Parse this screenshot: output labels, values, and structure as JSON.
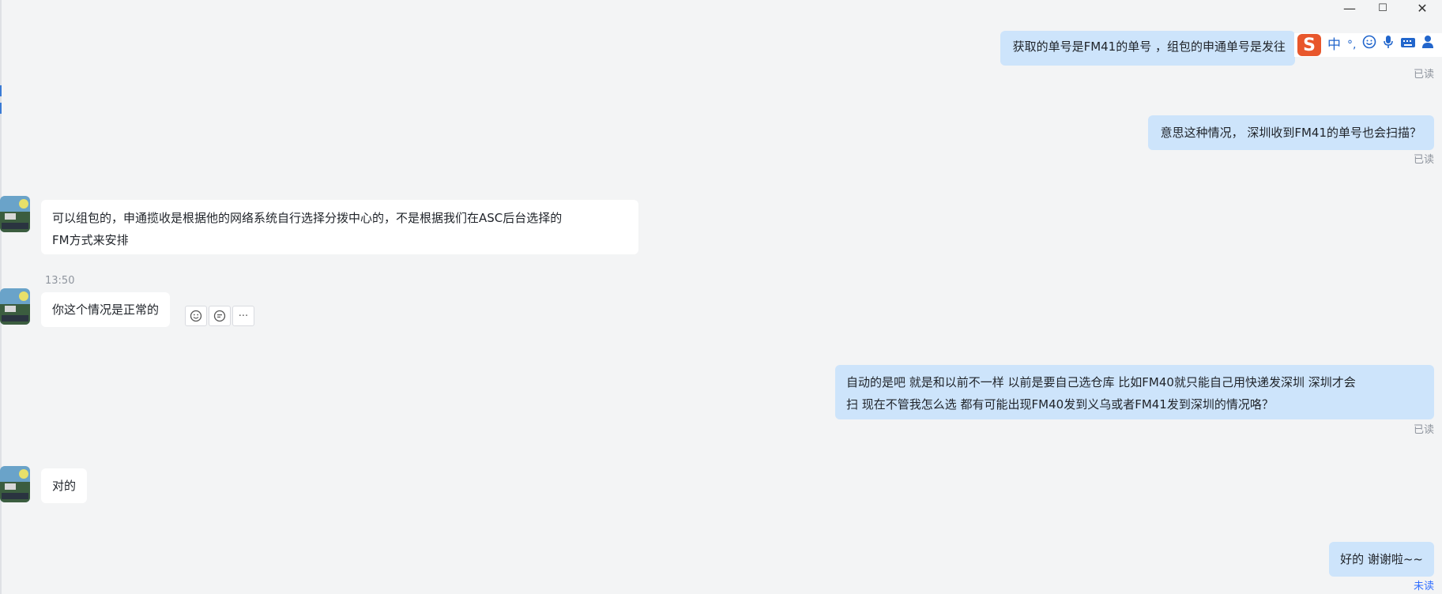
{
  "window": {
    "minimize_glyph": "—",
    "maximize_glyph": "☐",
    "close_glyph": "✕"
  },
  "messages": [
    {
      "dir": "out",
      "text": "获取的单号是FM41的单号 ，组包的申通单号是发往",
      "status": "已读"
    },
    {
      "dir": "out",
      "text": "意思这种情况， 深圳收到FM41的单号也会扫描？",
      "status": "已读"
    },
    {
      "dir": "in",
      "lines": [
        "可以组包的，申通揽收是根据他的网络系统自行选择分拨中心的，不是根据我们在ASC后台选择的",
        "FM方式来安排"
      ]
    },
    {
      "dir": "in",
      "time": "13:50",
      "text": "你这个情况是正常的"
    },
    {
      "dir": "out",
      "lines": [
        "自动的是吧  就是和以前不一样 以前是要自己选仓库 比如FM40就只能自己用快递发深圳 深圳才会",
        "扫  现在不管我怎么选 都有可能出现FM40发到义乌或者FM41发到深圳的情况咯？"
      ],
      "status": "已读"
    },
    {
      "dir": "in",
      "text": "对的"
    },
    {
      "dir": "out",
      "text": "好的 谢谢啦~~",
      "status": "未读"
    }
  ],
  "hover_actions": {
    "emoji_icon": "smile-icon",
    "reply_icon": "reply-icon",
    "more_label": "···"
  },
  "ime_toolbar": {
    "logo": "S",
    "lang": "中",
    "punct": "°,",
    "icons": [
      "smile-icon",
      "mic-icon",
      "keyboard-icon",
      "user-icon"
    ]
  },
  "colors": {
    "bg": "#f3f4f5",
    "outgoing_bubble": "#cde4fb",
    "incoming_bubble": "#ffffff",
    "read_text": "#8f959e",
    "unread_text": "#3370ff",
    "ime_logo": "#e8572c"
  }
}
